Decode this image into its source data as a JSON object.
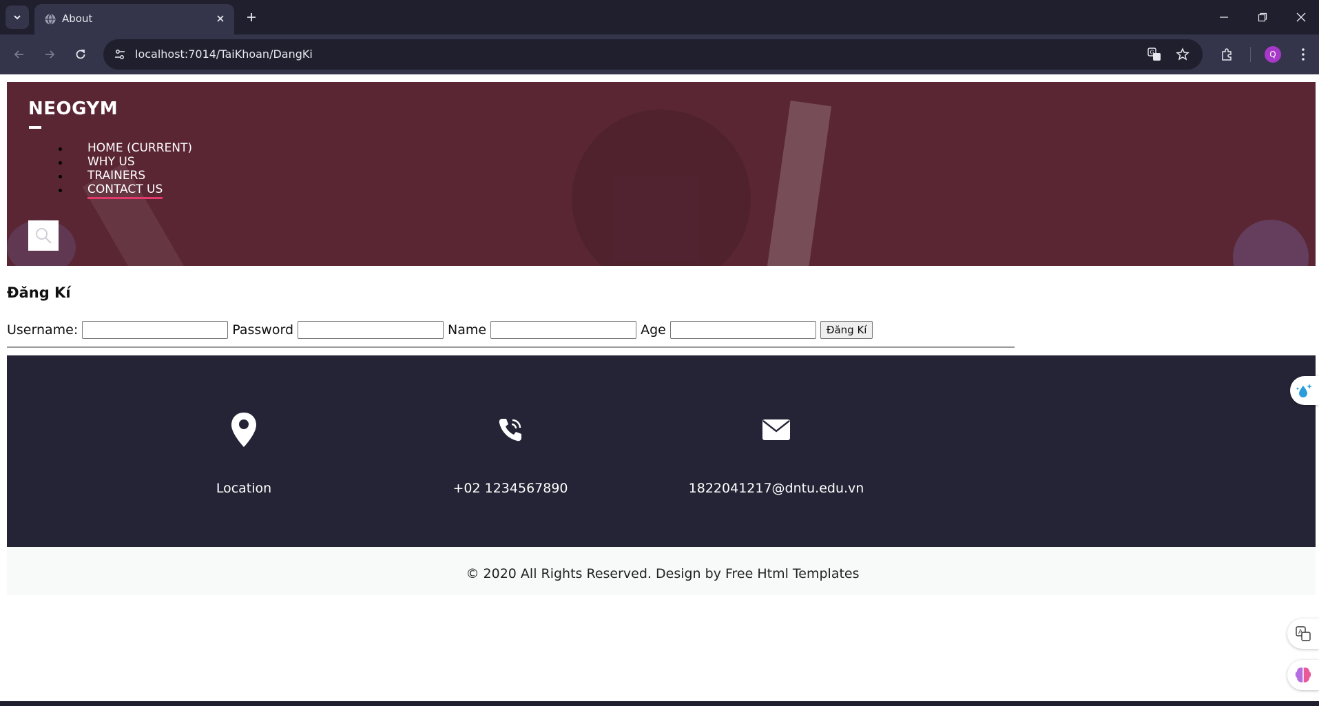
{
  "browser": {
    "tab_title": "About",
    "url": "localhost:7014/TaiKhoan/DangKi",
    "profile_initial": "Q"
  },
  "site": {
    "brand": "NEOGYM",
    "nav": [
      {
        "label": "HOME (CURRENT)"
      },
      {
        "label": "WHY US"
      },
      {
        "label": "TRAINERS"
      },
      {
        "label": "CONTACT US"
      }
    ],
    "active_nav": "CONTACT US"
  },
  "register": {
    "title": "Đăng Kí",
    "username_label": "Username:",
    "password_label": "Password",
    "name_label": "Name",
    "age_label": "Age",
    "username_value": "",
    "password_value": "",
    "name_value": "",
    "age_value": "",
    "submit_label": "Đăng Kí"
  },
  "info": {
    "location": "Location",
    "phone": "+02 1234567890",
    "email": "1822041217@dntu.edu.vn"
  },
  "footer": {
    "copyright": "© 2020 All Rights Reserved. Design by Free Html Templates"
  },
  "colors": {
    "hero_bg": "#5a2634",
    "info_bg": "#252436",
    "accent": "#e43a6a"
  }
}
